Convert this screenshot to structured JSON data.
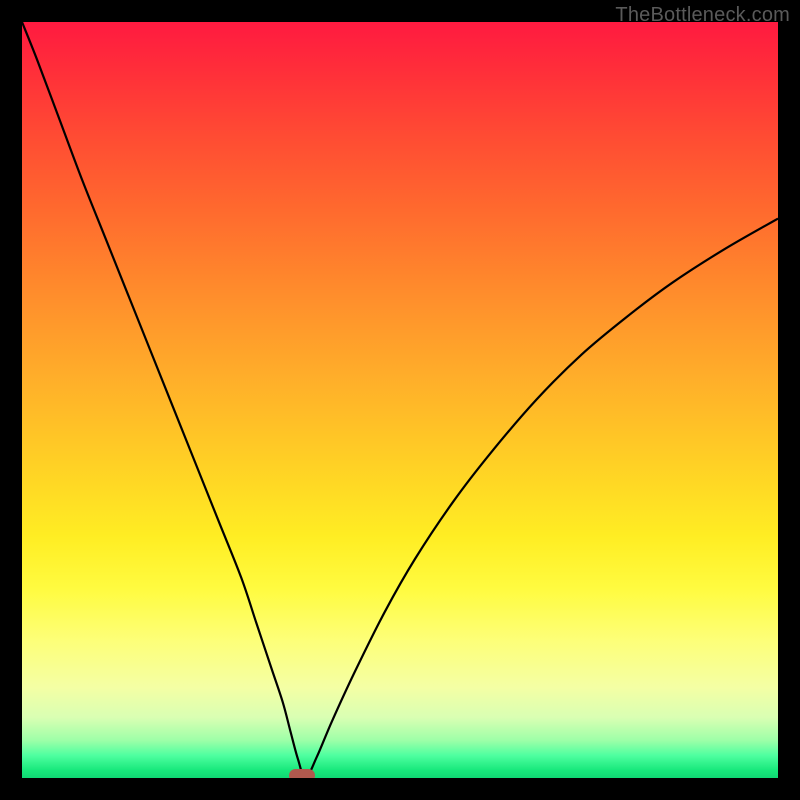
{
  "watermark": "TheBottleneck.com",
  "colors": {
    "black": "#000000",
    "curve": "#000000",
    "marker": "#b0594e",
    "gradient_top": "#ff1a40",
    "gradient_bottom": "#10d874"
  },
  "chart_data": {
    "type": "line",
    "title": "",
    "xlabel": "",
    "ylabel": "",
    "xlim": [
      0,
      100
    ],
    "ylim": [
      0,
      100
    ],
    "grid": false,
    "annotations": [
      "TheBottleneck.com"
    ],
    "marker": {
      "x": 37,
      "y": 0
    },
    "series": [
      {
        "name": "curve",
        "x": [
          0,
          2,
          5,
          8,
          11,
          14,
          17,
          20,
          23,
          26,
          29,
          31,
          33,
          34.5,
          35.5,
          36.5,
          37.5,
          39,
          41,
          44,
          48,
          52,
          57,
          62,
          68,
          74,
          80,
          86,
          93,
          100
        ],
        "y": [
          100,
          95,
          87,
          79,
          71.5,
          64,
          56.5,
          49,
          41.5,
          34,
          26.5,
          20.5,
          14.5,
          10,
          6.2,
          2.5,
          0,
          2.8,
          7.5,
          14,
          22,
          29,
          36.5,
          43,
          50,
          56,
          61,
          65.5,
          70,
          74
        ]
      }
    ]
  }
}
